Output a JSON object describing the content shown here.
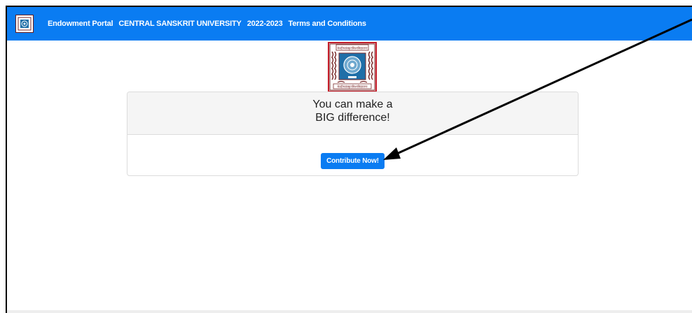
{
  "navbar": {
    "links": [
      "Endowment Portal",
      "CENTRAL SANSKRIT UNIVERSITY",
      "2022-2023",
      "Terms and Conditions"
    ]
  },
  "emblem": {
    "top_text": "केन्द्रीयसंस्कृतविश्वविद्यालयः",
    "bottom_text": "केन्द्रीयसंस्कृतविश्वविद्यालयः"
  },
  "card": {
    "line1": "You can make a",
    "line2": "BIG difference!",
    "button_label": "Contribute Now!"
  },
  "colors": {
    "navbar": "#0a7cf2",
    "button": "#0a7cf2",
    "emblem_border": "#c61d2a"
  }
}
